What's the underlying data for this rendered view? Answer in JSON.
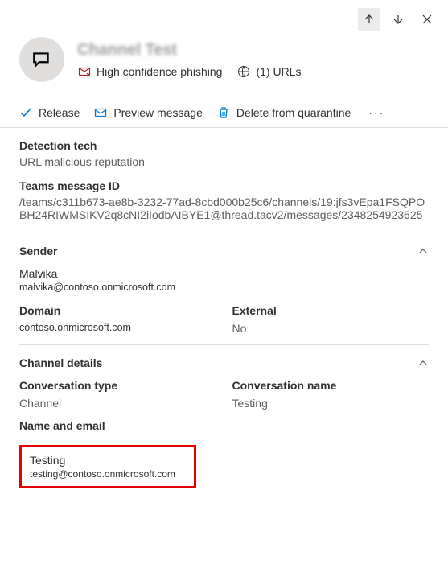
{
  "topbar": {
    "up_tip": "Previous",
    "down_tip": "Next",
    "close_tip": "Close"
  },
  "header": {
    "title": "Channel Test",
    "phishing_label": "High confidence phishing",
    "urls_label": "(1) URLs"
  },
  "commands": {
    "release": "Release",
    "preview": "Preview message",
    "delete": "Delete from quarantine",
    "more": "···"
  },
  "details": {
    "detection_tech_label": "Detection tech",
    "detection_tech_value": "URL malicious reputation",
    "teams_id_label": "Teams message ID",
    "teams_id_value": "/teams/c311b673-ae8b-3232-77ad-8cbd000b25c6/channels/19:jfs3vEpa1FSQPOBH24RIWMSIKV2q8cNI2iIodbAIBYE1@thread.tacv2/messages/2348254923625"
  },
  "sender": {
    "section_label": "Sender",
    "name": "Malvika",
    "email": "malvika@contoso.onmicrosoft.com",
    "domain_label": "Domain",
    "domain_value": "contoso.onmicrosoft.com",
    "external_label": "External",
    "external_value": "No"
  },
  "channel": {
    "section_label": "Channel details",
    "conv_type_label": "Conversation type",
    "conv_type_value": "Channel",
    "conv_name_label": "Conversation name",
    "conv_name_value": "Testing",
    "name_email_label": "Name and email",
    "entity_name": "Testing",
    "entity_email": "testing@contoso.onmicrosoft.com"
  }
}
